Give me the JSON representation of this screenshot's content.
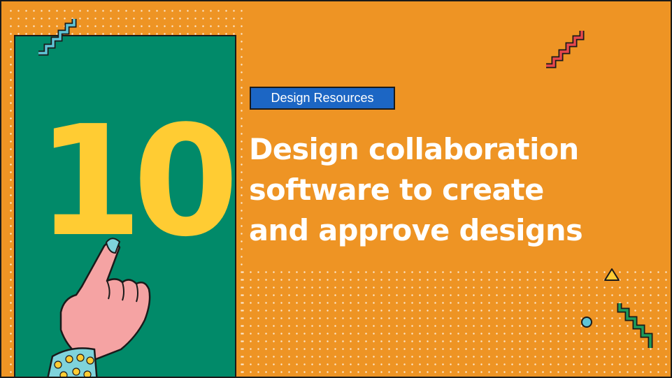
{
  "badge": {
    "label": "Design Resources"
  },
  "number": "10",
  "headline": {
    "line1": "Design collaboration",
    "line2": "software to create",
    "line3": "and approve designs"
  },
  "colors": {
    "background": "#EE9424",
    "panel": "#018A69",
    "number": "#FFCC33",
    "badge": "#1C66C4",
    "text": "#FFFFFF"
  },
  "icons": [
    "zigzag-teal-icon",
    "zigzag-red-icon",
    "zigzag-green-icon",
    "triangle-icon",
    "circle-icon",
    "pointing-hand-icon"
  ]
}
